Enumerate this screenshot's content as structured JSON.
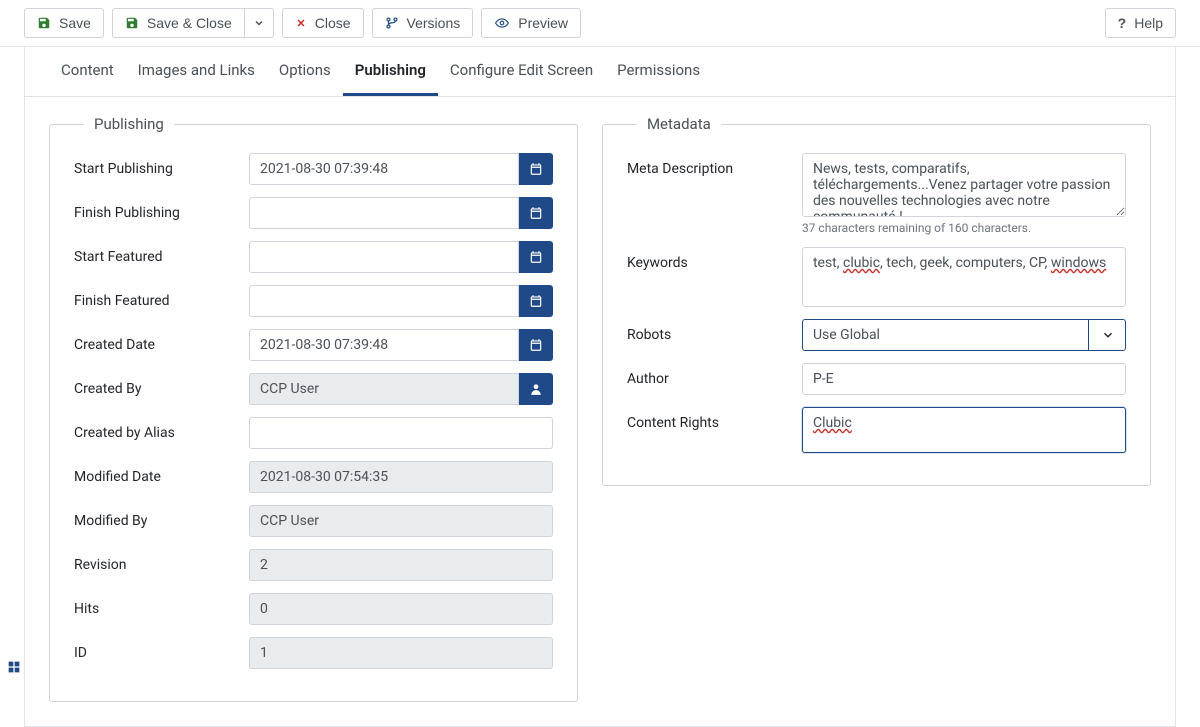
{
  "toolbar": {
    "save": "Save",
    "save_close": "Save & Close",
    "close": "Close",
    "versions": "Versions",
    "preview": "Preview",
    "help": "Help"
  },
  "tabs": {
    "content": "Content",
    "images_links": "Images and Links",
    "options": "Options",
    "publishing": "Publishing",
    "configure": "Configure Edit Screen",
    "permissions": "Permissions"
  },
  "publishing": {
    "legend": "Publishing",
    "start_publishing_label": "Start Publishing",
    "start_publishing_value": "2021-08-30 07:39:48",
    "finish_publishing_label": "Finish Publishing",
    "finish_publishing_value": "",
    "start_featured_label": "Start Featured",
    "start_featured_value": "",
    "finish_featured_label": "Finish Featured",
    "finish_featured_value": "",
    "created_date_label": "Created Date",
    "created_date_value": "2021-08-30 07:39:48",
    "created_by_label": "Created By",
    "created_by_value": "CCP User",
    "created_by_alias_label": "Created by Alias",
    "created_by_alias_value": "",
    "modified_date_label": "Modified Date",
    "modified_date_value": "2021-08-30 07:54:35",
    "modified_by_label": "Modified By",
    "modified_by_value": "CCP User",
    "revision_label": "Revision",
    "revision_value": "2",
    "hits_label": "Hits",
    "hits_value": "0",
    "id_label": "ID",
    "id_value": "1"
  },
  "metadata": {
    "legend": "Metadata",
    "meta_description_label": "Meta Description",
    "meta_description_value": "News, tests, comparatifs, téléchargements...Venez partager votre passion des nouvelles technologies avec notre communauté !",
    "meta_description_hint": "37 characters remaining of 160 characters.",
    "keywords_label": "Keywords",
    "keywords_value": "test, clubic, tech, geek, computers, CP, windows",
    "robots_label": "Robots",
    "robots_value": "Use Global",
    "author_label": "Author",
    "author_value": "P-E",
    "content_rights_label": "Content Rights",
    "content_rights_value": "Clubic"
  }
}
